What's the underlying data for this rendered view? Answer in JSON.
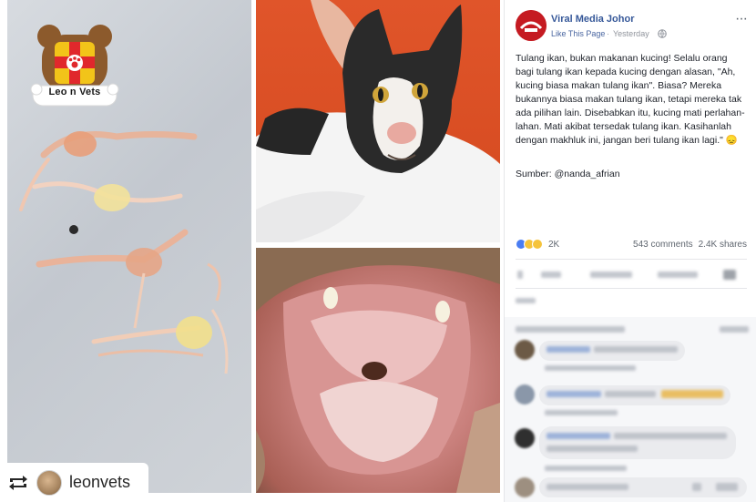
{
  "collage": {
    "logo_text": "Leo n Vets",
    "repost_handle": "leonvets"
  },
  "post": {
    "page_name": "Viral Media Johor",
    "like_link": "Like This Page",
    "separator": "·",
    "time": "Yesterday",
    "more": "···",
    "body": "Tulang ikan, bukan makanan kucing! Selalu orang bagi tulang ikan kepada kucing dengan alasan, \"Ah, kucing biasa makan tulang ikan\". Biasa? Mereka bukannya biasa makan tulang ikan, tetapi mereka tak ada pilihan lain. Disebabkan itu, kucing mati perlahan-lahan. Mati akibat tersedak tulang ikan. Kasihanlah dengan makhluk ini, jangan beri tulang ikan lagi.\" 😞",
    "source": "Sumber: @nanda_afrian",
    "reaction_count": "2K",
    "comments": "543 comments",
    "shares": "2.4K shares"
  },
  "colors": {
    "link": "#365899",
    "page_brand": "#c51b22",
    "text": "#1d2129",
    "muted": "#90949c"
  },
  "icons": [
    "repost-icon",
    "globe-icon",
    "more-icon",
    "like-reaction-icon",
    "sad-reaction-icon",
    "wow-reaction-icon"
  ]
}
